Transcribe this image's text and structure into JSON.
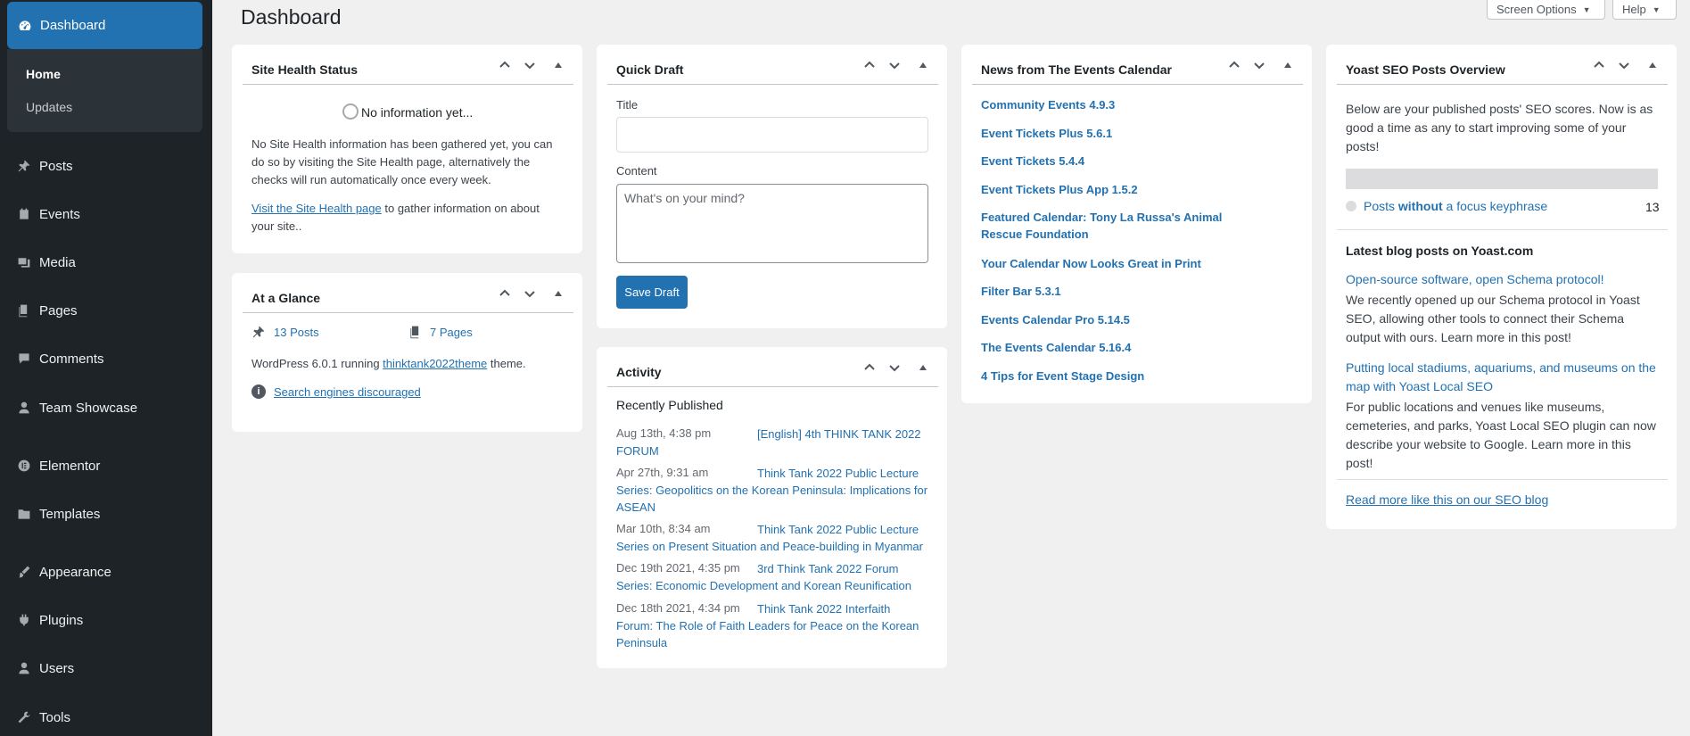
{
  "header": {
    "page_title": "Dashboard",
    "screen_options": "Screen Options",
    "help": "Help"
  },
  "sidebar": {
    "dashboard": "Dashboard",
    "submenu": [
      "Home",
      "Updates"
    ],
    "items": [
      {
        "label": "Posts",
        "icon": "pin-icon"
      },
      {
        "label": "Events",
        "icon": "calendar-icon"
      },
      {
        "label": "Media",
        "icon": "media-icon"
      },
      {
        "label": "Pages",
        "icon": "pages-icon"
      },
      {
        "label": "Comments",
        "icon": "comments-icon"
      },
      {
        "label": "Team Showcase",
        "icon": "user-icon"
      },
      {
        "label": "Elementor",
        "icon": "elementor-icon"
      },
      {
        "label": "Templates",
        "icon": "folder-icon"
      },
      {
        "label": "Appearance",
        "icon": "brush-icon"
      },
      {
        "label": "Plugins",
        "icon": "plugin-icon"
      },
      {
        "label": "Users",
        "icon": "users-icon"
      },
      {
        "label": "Tools",
        "icon": "wrench-icon"
      }
    ]
  },
  "site_health": {
    "title": "Site Health Status",
    "status": "No information yet...",
    "description": "No Site Health information has been gathered yet, you can do so by visiting the Site Health page, alternatively the checks will run automatically once every week.",
    "link": "Visit the Site Health page",
    "link_suffix": " to gather information on about your site.."
  },
  "at_a_glance": {
    "title": "At a Glance",
    "posts": "13 Posts",
    "pages": "7 Pages",
    "wp_prefix": "WordPress 6.0.1 running ",
    "theme": "thinktank2022theme",
    "wp_suffix": " theme.",
    "search_engines": "Search engines discouraged"
  },
  "quick_draft": {
    "title": "Quick Draft",
    "title_label": "Title",
    "title_value": "",
    "content_label": "Content",
    "content_placeholder": "What's on your mind?",
    "save_label": "Save Draft"
  },
  "activity": {
    "title": "Activity",
    "subtitle": "Recently Published",
    "items": [
      {
        "date": "Aug 13th, 4:38 pm",
        "title": "[English] 4th THINK TANK 2022 FORUM"
      },
      {
        "date": "Apr 27th, 9:31 am",
        "title": "Think Tank 2022 Public Lecture Series: Geopolitics on the Korean Peninsula: Implications for ASEAN"
      },
      {
        "date": "Mar 10th, 8:34 am",
        "title": "Think Tank 2022 Public Lecture Series on Present Situation and Peace-building in Myanmar"
      },
      {
        "date": "Dec 19th 2021, 4:35 pm",
        "title": "3rd Think Tank 2022 Forum Series: Economic Development and Korean Reunification"
      },
      {
        "date": "Dec 18th 2021, 4:34 pm",
        "title": "Think Tank 2022 Interfaith Forum: The Role of Faith Leaders for Peace on the Korean Peninsula"
      }
    ]
  },
  "news": {
    "title": "News from The Events Calendar",
    "items": [
      "Community Events 4.9.3",
      "Event Tickets Plus 5.6.1",
      "Event Tickets 5.4.4",
      "Event Tickets Plus App 1.5.2",
      "Featured Calendar: Tony La Russa's Animal Rescue Foundation",
      "Your Calendar Now Looks Great in Print",
      "Filter Bar 5.3.1",
      "Events Calendar Pro 5.14.5",
      "The Events Calendar 5.16.4",
      "4 Tips for Event Stage Design"
    ]
  },
  "yoast": {
    "title": "Yoast SEO Posts Overview",
    "intro": "Below are your published posts' SEO scores. Now is as good a time as any to start improving some of your posts!",
    "row_prefix": "Posts ",
    "row_emphasis": "without",
    "row_suffix": " a focus keyphrase",
    "row_count": "13",
    "latest_heading": "Latest blog posts on Yoast.com",
    "posts": [
      {
        "title": "Open-source software, open Schema protocol!",
        "excerpt": "We recently opened up our Schema protocol in Yoast SEO, allowing other tools to connect their Schema output with ours. Learn more in this post!"
      },
      {
        "title": "Putting local stadiums, aquariums, and museums on the map with Yoast Local SEO",
        "excerpt": "For public locations and venues like museums, cemeteries, and parks, Yoast Local SEO plugin can now describe your website to Google. Learn more in this post!"
      }
    ],
    "read_more": "Read more like this on our SEO blog"
  },
  "colors": {
    "sidebar_bg": "#1d2327",
    "accent": "#2271b1",
    "page_bg": "#f0f0f1"
  }
}
